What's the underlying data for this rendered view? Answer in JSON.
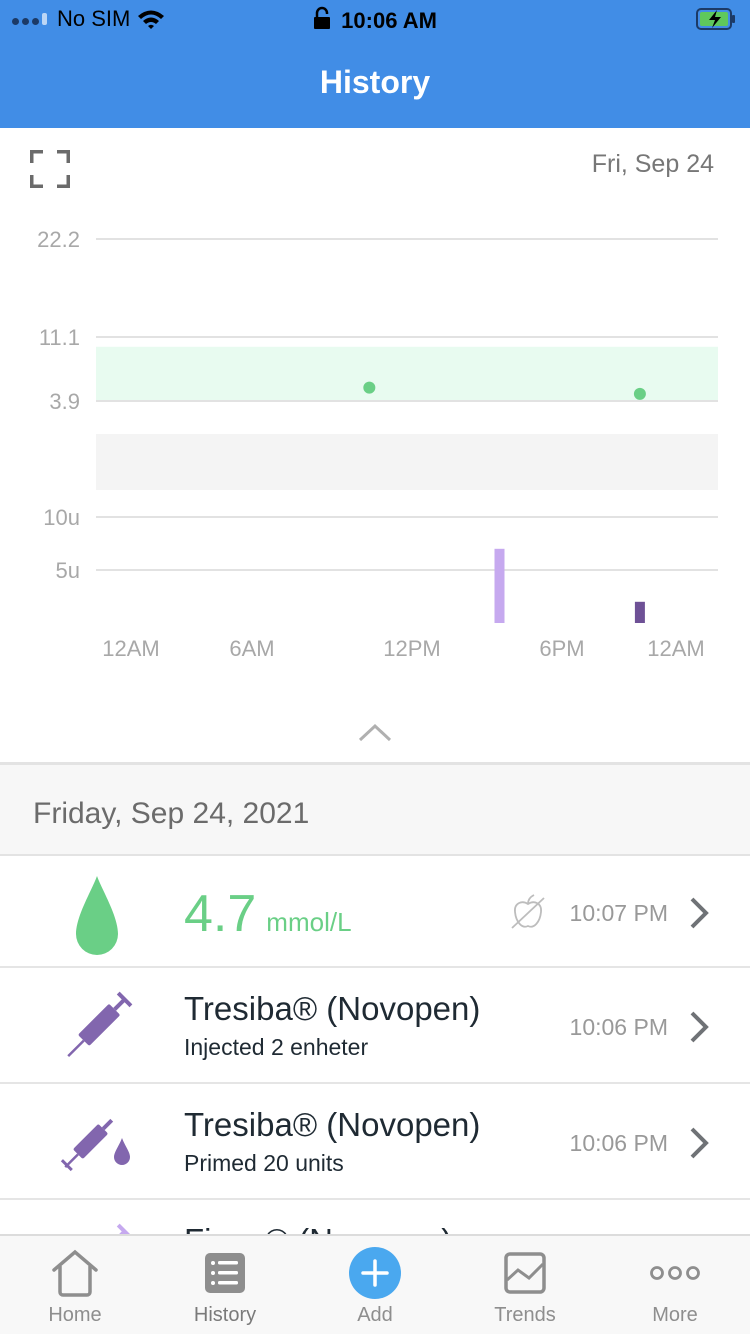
{
  "status_bar": {
    "carrier": "No SIM",
    "time": "10:06 AM",
    "battery_state": "charging"
  },
  "nav": {
    "title": "History"
  },
  "chart_header": {
    "expand_icon": "expand-icon",
    "date": "Fri, Sep 24"
  },
  "chart_data": {
    "type": "scatter",
    "title": "",
    "date": "Fri, Sep 24",
    "x_axis": {
      "unit": "hour",
      "range": [
        0,
        24
      ],
      "tick_values": [
        0,
        6,
        12,
        18,
        24
      ],
      "tick_labels": [
        "12AM",
        "6AM",
        "12PM",
        "6PM",
        "12AM"
      ]
    },
    "glucose": {
      "unit": "mmol/L",
      "tick_values": [
        22.2,
        11.1,
        3.9
      ],
      "tick_labels": [
        "22.2",
        "11.1",
        "3.9"
      ],
      "target_range": [
        3.9,
        10.0
      ],
      "points": [
        {
          "hour": 10.4,
          "value": 5.4
        },
        {
          "hour": 22.1,
          "value": 4.7
        }
      ],
      "colors": {
        "point": "#6acf86",
        "target_band": "#e8fbf0"
      }
    },
    "insulin": {
      "type": "bar",
      "unit": "u",
      "tick_values": [
        10,
        5
      ],
      "tick_labels": [
        "10u",
        "5u"
      ],
      "range": [
        0,
        10
      ],
      "bars": [
        {
          "hour": 15.5,
          "value": 7,
          "kind": "bolus",
          "color": "#c6a9ef"
        },
        {
          "hour": 22.1,
          "value": 2,
          "kind": "basal",
          "color": "#6e5196"
        }
      ]
    },
    "grid": true,
    "legend": "none"
  },
  "section": {
    "date": "Friday, Sep 24, 2021"
  },
  "entries": [
    {
      "type": "glucose",
      "icon": "blood-drop-icon",
      "value": "4.7",
      "unit": "mmol/L",
      "tag_icon": "no-meal-icon",
      "time": "10:07 PM"
    },
    {
      "type": "injection",
      "icon": "syringe-icon",
      "title": "Tresiba® (Novopen)",
      "subtitle": "Injected 2 enheter",
      "time": "10:06 PM"
    },
    {
      "type": "prime",
      "icon": "syringe-drop-icon",
      "title": "Tresiba® (Novopen)",
      "subtitle": "Primed 20 units",
      "time": "10:06 PM"
    },
    {
      "type": "injection",
      "icon": "syringe-icon",
      "title": "Fiasp® (Novopen)",
      "subtitle": "",
      "time": ""
    }
  ],
  "tabbar": {
    "tabs": [
      {
        "label": "Home",
        "icon": "home-icon",
        "active": false
      },
      {
        "label": "History",
        "icon": "list-icon",
        "active": true
      },
      {
        "label": "Add",
        "icon": "plus-circle-icon",
        "active": false
      },
      {
        "label": "Trends",
        "icon": "trends-icon",
        "active": false
      },
      {
        "label": "More",
        "icon": "more-icon",
        "active": false
      }
    ]
  },
  "colors": {
    "header_blue": "#418de6",
    "glucose_green": "#6acf86",
    "insulin_purple": "#8266ae",
    "add_blue": "#4aa8ef"
  }
}
